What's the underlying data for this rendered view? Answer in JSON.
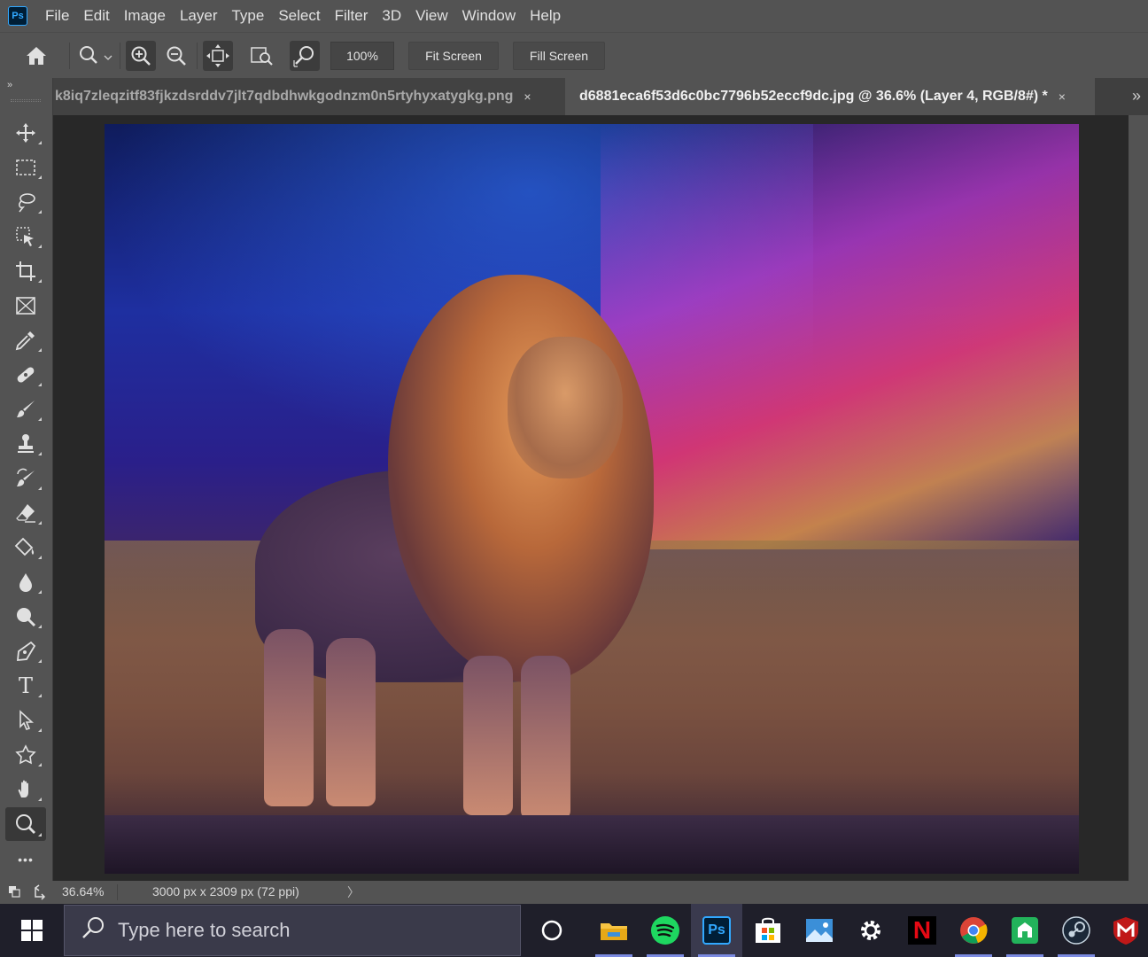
{
  "app": {
    "logo_text": "Ps"
  },
  "menu": [
    "File",
    "Edit",
    "Image",
    "Layer",
    "Type",
    "Select",
    "Filter",
    "3D",
    "View",
    "Window",
    "Help"
  ],
  "options_bar": {
    "zoom_value": "100%",
    "fit_screen_label": "Fit Screen",
    "fill_screen_label": "Fill Screen"
  },
  "tabs": [
    {
      "title": "k8iq7zleqzitf83fjkzdsrddv7jlt7qdbdhwkgodnzm0n5rtyhyxatygkg.png",
      "close": "×",
      "active": false
    },
    {
      "title": "d6881eca6f53d6c0bc7796b52eccf9dc.jpg @ 36.6% (Layer 4, RGB/8#) *",
      "close": "×",
      "active": true
    }
  ],
  "tab_overflow": "»",
  "toolbar": {
    "collapse": "»",
    "tools": [
      "move-tool",
      "marquee-tool",
      "lasso-tool",
      "object-select-tool",
      "crop-tool",
      "frame-tool",
      "eyedropper-tool",
      "healing-tool",
      "brush-tool",
      "stamp-tool",
      "history-brush-tool",
      "eraser-tool",
      "paint-bucket-tool",
      "blur-tool",
      "dodge-tool",
      "pen-tool",
      "type-tool",
      "path-select-tool",
      "custom-shape-tool",
      "hand-tool",
      "zoom-tool",
      "more-tools"
    ],
    "active_tool": "zoom-tool",
    "type_glyph": "T",
    "more_glyph": "•••"
  },
  "status": {
    "zoom": "36.64%",
    "doc_info": "3000 px x 2309 px (72 ppi)",
    "arrow": "〉"
  },
  "taskbar": {
    "search_placeholder": "Type here to search",
    "apps": [
      "cortana-icon",
      "file-explorer-icon",
      "spotify-icon",
      "photoshop-icon",
      "ms-store-icon",
      "photos-icon",
      "settings-icon",
      "netflix-icon",
      "chrome-icon",
      "app-icon",
      "steam-icon",
      "mcafee-icon"
    ],
    "ps_label": "Ps",
    "netflix_label": "N"
  },
  "colors": {
    "panel": "#535353",
    "canvas_bg": "#282828",
    "taskbar": "#1f1f2a",
    "ps_blue": "#31a8ff"
  }
}
